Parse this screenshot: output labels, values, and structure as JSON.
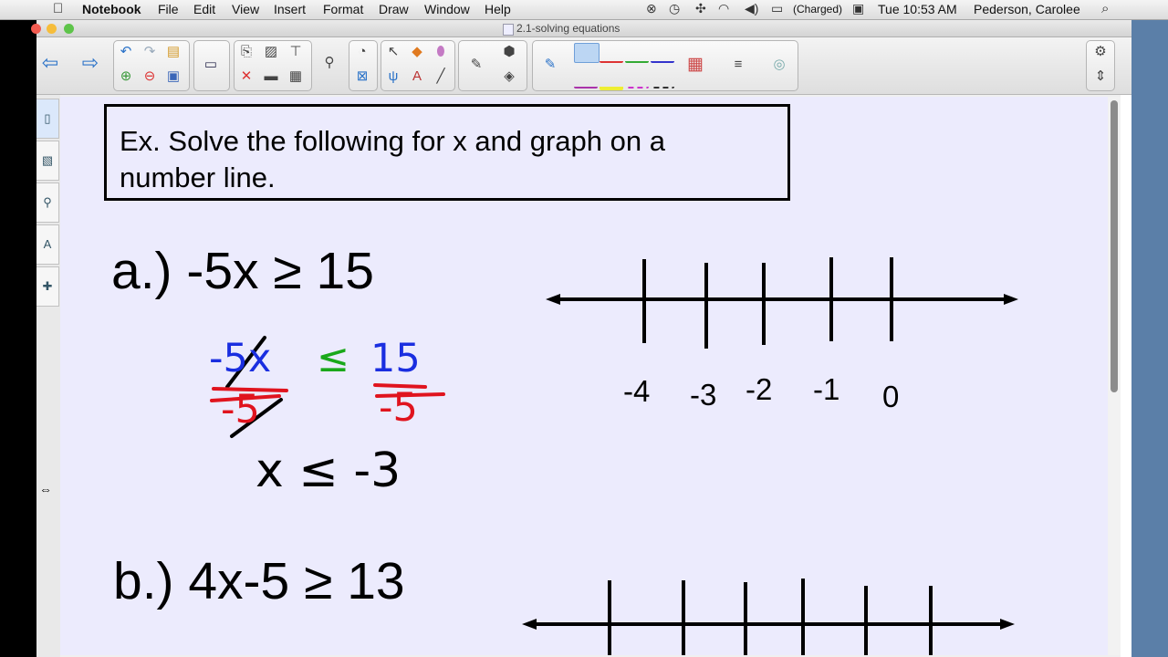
{
  "menubar": {
    "apple_glyph": "",
    "app_name": "Notebook",
    "menus": [
      "File",
      "Edit",
      "View",
      "Insert",
      "Format",
      "Draw",
      "Window",
      "Help"
    ],
    "battery_status": "(Charged)",
    "clock": "Tue 10:53 AM",
    "user": "Pederson, Carolee"
  },
  "window": {
    "title": "2.1-solving equations"
  },
  "canvas": {
    "prompt_line1": "Ex.   Solve the following for x and graph on a",
    "prompt_line2": "number line.",
    "problem_a": "a.) -5x ≥ 15",
    "problem_b": "b.) 4x-5 ≥ 13",
    "numberline_a_labels": [
      "-4",
      "-3",
      "-2",
      "-1",
      "0"
    ],
    "handwriting": {
      "step1_left": "-5x",
      "step1_sign": "≤",
      "step1_right": "15",
      "divisor_left": "-5",
      "divisor_right": "-5",
      "answer": "x ≤ -3"
    }
  },
  "colors": {
    "canvas_bg": "#ecebfd",
    "ink_blue": "#1a2ee0",
    "ink_red": "#e0141e",
    "ink_green": "#1aa81a",
    "ink_black": "#000000",
    "pen_highlight": "#bcd6f3"
  },
  "icons": {
    "toolbar": [
      "back-arrow-icon",
      "forward-arrow-icon",
      "undo-icon",
      "redo-icon",
      "open-icon",
      "add-page-icon",
      "delete-page-icon",
      "save-icon",
      "screen-shade-icon",
      "paste-icon",
      "delete-icon",
      "table-icon",
      "select-icon",
      "shapes-icon",
      "eraser-icon",
      "pen-icon",
      "color-palette-icon",
      "line-style-icon",
      "settings-gear-icon"
    ]
  }
}
